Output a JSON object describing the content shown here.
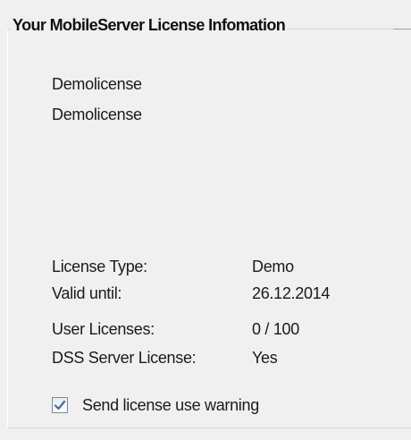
{
  "groupbox": {
    "title": "Your MobileServer License Infomation"
  },
  "license": {
    "line1": "Demolicense",
    "line2": "Demolicense"
  },
  "details": [
    {
      "label": "License Type:",
      "value": "Demo"
    },
    {
      "label": "Valid until:",
      "value": "26.12.2014"
    },
    {
      "label": "User Licenses:",
      "value": "0 / 100"
    },
    {
      "label": "DSS Server License:",
      "value": "Yes"
    }
  ],
  "options": {
    "send_warning_label": "Send license use warning",
    "send_warning_checked": true
  },
  "colors": {
    "background": "#f0f0f0",
    "check_mark": "#4a6a9a"
  },
  "icons": {
    "checkbox": "checkmark-icon"
  }
}
